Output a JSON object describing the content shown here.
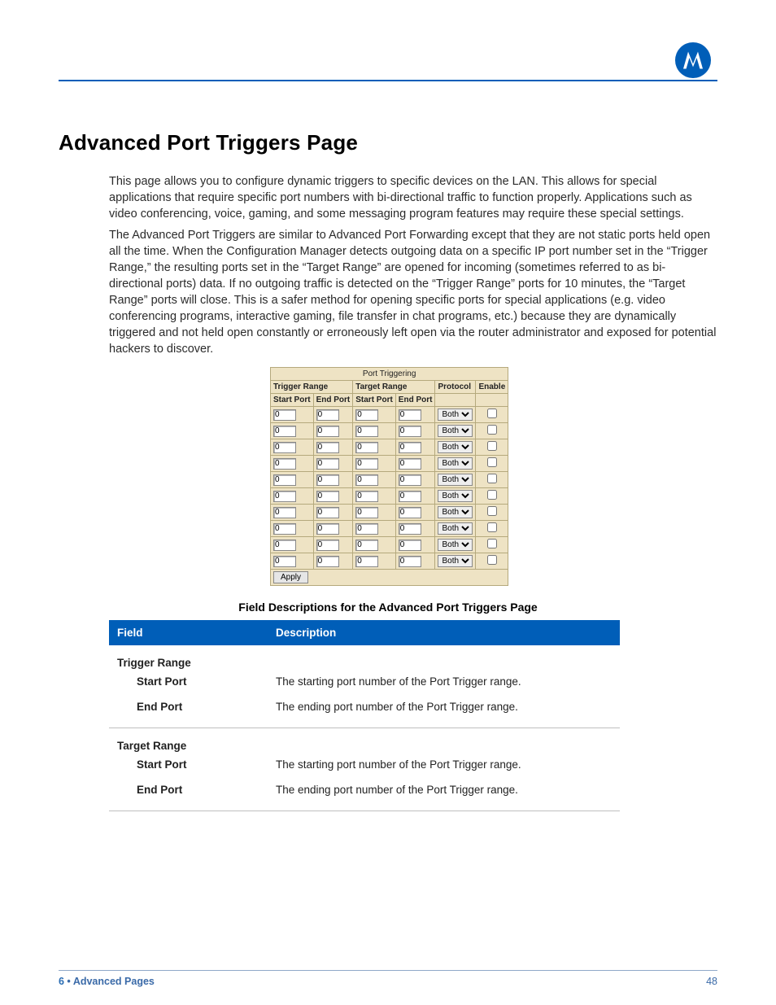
{
  "brand": {
    "logo_label": "Motorola logo"
  },
  "page": {
    "title": "Advanced Port Triggers Page",
    "p1": "This page allows you to configure dynamic triggers to specific devices on the LAN. This allows for special applications that require specific port numbers with bi-directional traffic to function properly. Applications such as video conferencing, voice, gaming, and some messaging program features may require these special settings.",
    "p2": "The Advanced Port Triggers are similar to Advanced Port Forwarding except that they are not static ports held open all the time. When the Configuration Manager detects outgoing data on a specific IP port number set in the “Trigger Range,” the resulting ports set in the “Target Range” are opened for incoming (sometimes referred to as bi-directional ports) data. If no outgoing traffic is detected on the “Trigger Range” ports for 10 minutes, the “Target Range” ports will close. This is a safer method for opening specific ports for special applications (e.g. video conferencing programs, interactive gaming, file transfer in chat programs, etc.) because they are dynamically triggered and not held open constantly or erroneously left open via the router administrator and exposed for potential hackers to discover."
  },
  "pt": {
    "title": "Port Triggering",
    "trigger_range": "Trigger Range",
    "target_range": "Target Range",
    "protocol": "Protocol",
    "enable": "Enable",
    "start_port": "Start Port",
    "end_port": "End Port",
    "protocol_option": "Both",
    "default_value": "0",
    "apply": "Apply",
    "row_count": 10
  },
  "fielddesc": {
    "heading": "Field Descriptions for the Advanced Port Triggers Page",
    "col_field": "Field",
    "col_desc": "Description",
    "sections": [
      {
        "name": "Trigger Range",
        "fields": [
          {
            "name": "Start Port",
            "desc": "The starting port number of the Port Trigger range."
          },
          {
            "name": "End Port",
            "desc": "The ending port number of the Port Trigger range."
          }
        ]
      },
      {
        "name": "Target Range",
        "fields": [
          {
            "name": "Start Port",
            "desc": "The starting port number of the Port Trigger range."
          },
          {
            "name": "End Port",
            "desc": "The ending port number of the Port Trigger range."
          }
        ]
      }
    ]
  },
  "footer": {
    "chapter_num": "6",
    "bullet": " • ",
    "chapter_title": "Advanced Pages",
    "page_num": "48"
  }
}
